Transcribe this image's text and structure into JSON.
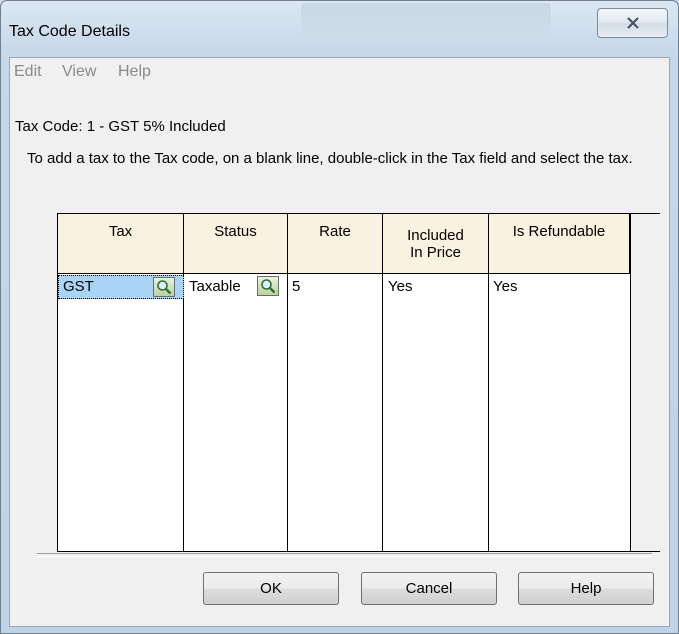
{
  "window": {
    "title": "Tax Code Details"
  },
  "menu": [
    "Edit",
    "View",
    "Help"
  ],
  "tax_code_line": "Tax Code: 1 - GST 5% Included",
  "instruction": "To add a tax to the Tax code, on a blank line, double-click in the Tax field and select the tax.",
  "table": {
    "headers": [
      "Tax",
      "Status",
      "Rate",
      "Included In Price",
      "Is Refundable"
    ],
    "rows": [
      {
        "tax": "GST",
        "status": "Taxable",
        "rate": "5",
        "included": "Yes",
        "refundable": "Yes"
      }
    ]
  },
  "buttons": {
    "ok": "OK",
    "cancel": "Cancel",
    "help": "Help"
  },
  "icons": {
    "close": "close-icon",
    "lookup": "magnifier-lookup-icon"
  }
}
